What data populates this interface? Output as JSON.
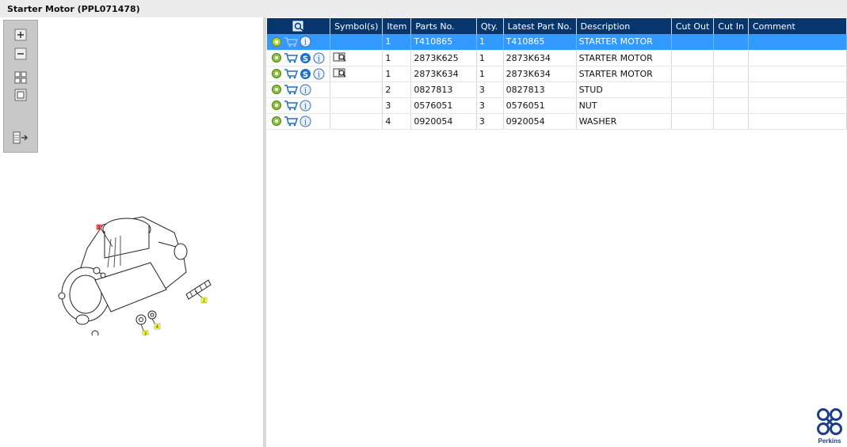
{
  "window": {
    "title": "Starter Motor (PPL071478)"
  },
  "table": {
    "columns": [
      "",
      "Symbol(s)",
      "Item",
      "Parts No.",
      "Qty.",
      "Latest Part No.",
      "Description",
      "Cut Out",
      "Cut In",
      "Comment"
    ],
    "rows": [
      {
        "item": "1",
        "part_no": "T410865",
        "qty": "1",
        "latest_part_no": "T410865",
        "description": "STARTER MOTOR",
        "cut_out": "",
        "cut_in": "",
        "comment": ""
      },
      {
        "item": "1",
        "part_no": "2873K625",
        "qty": "1",
        "latest_part_no": "2873K634",
        "description": "STARTER MOTOR",
        "cut_out": "",
        "cut_in": "",
        "comment": ""
      },
      {
        "item": "1",
        "part_no": "2873K634",
        "qty": "1",
        "latest_part_no": "2873K634",
        "description": "STARTER MOTOR",
        "cut_out": "",
        "cut_in": "",
        "comment": ""
      },
      {
        "item": "2",
        "part_no": "0827813",
        "qty": "3",
        "latest_part_no": "0827813",
        "description": "STUD",
        "cut_out": "",
        "cut_in": "",
        "comment": ""
      },
      {
        "item": "3",
        "part_no": "0576051",
        "qty": "3",
        "latest_part_no": "0576051",
        "description": "NUT",
        "cut_out": "",
        "cut_in": "",
        "comment": ""
      },
      {
        "item": "4",
        "part_no": "0920054",
        "qty": "3",
        "latest_part_no": "0920054",
        "description": "WASHER",
        "cut_out": "",
        "cut_in": "",
        "comment": ""
      }
    ]
  },
  "drawing": {
    "callouts": [
      "1",
      "2",
      "3",
      "4"
    ]
  },
  "logo": {
    "text": "Perkins"
  },
  "colors": {
    "header_bg": "#07366e",
    "selected_row": "#3399ff",
    "callout_yellow": "#ffff33",
    "callout_red": "#ff6666"
  }
}
